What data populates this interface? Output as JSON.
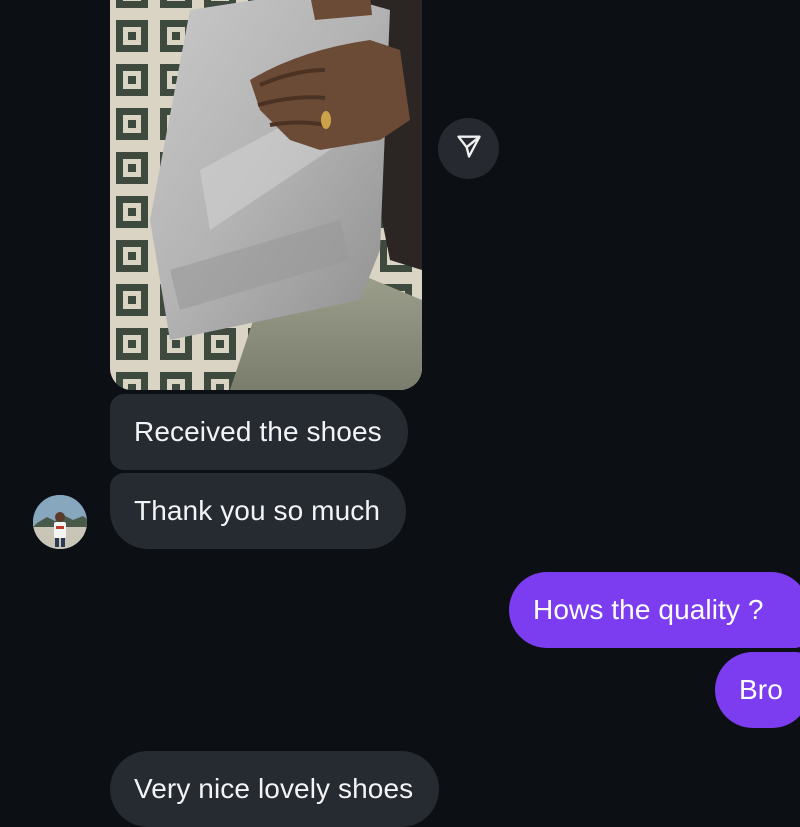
{
  "thread": {
    "incoming_media": {
      "type": "photo",
      "share_icon": "send-paper-plane-icon"
    },
    "contact_avatar_icon": "contact-avatar",
    "messages": [
      {
        "from": "contact",
        "text": "Received the shoes"
      },
      {
        "from": "contact",
        "text": "Thank you so much"
      },
      {
        "from": "me",
        "text": "Hows the quality ?"
      },
      {
        "from": "me",
        "text": "Bro"
      },
      {
        "from": "contact",
        "text": "Very nice lovely shoes"
      }
    ]
  },
  "colors": {
    "background": "#0c1014",
    "incoming_bubble": "#262a31",
    "outgoing_bubble": "#7c3cf0",
    "text": "#f3f4f6"
  }
}
